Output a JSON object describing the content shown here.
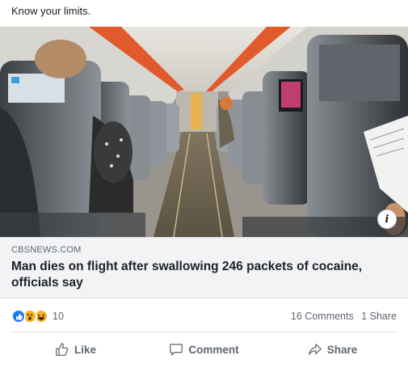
{
  "post": {
    "caption": "Know your limits."
  },
  "link": {
    "domain": "CBSNEWS.COM",
    "headline": "Man dies on flight after swallowing 246 packets of cocaine, officials say",
    "info_glyph": "i"
  },
  "reactions": {
    "icons": [
      "like-icon",
      "wow-icon",
      "haha-icon"
    ],
    "count": "10"
  },
  "engagement": {
    "comments": "16 Comments",
    "shares": "1 Share"
  },
  "actions": {
    "like_label": "Like",
    "comment_label": "Comment",
    "share_label": "Share"
  },
  "colors": {
    "like_blue": "#1877f2",
    "emoji_yellow": "#f7b125",
    "link_box_bg": "#f2f3f5",
    "secondary_text": "#606770"
  }
}
